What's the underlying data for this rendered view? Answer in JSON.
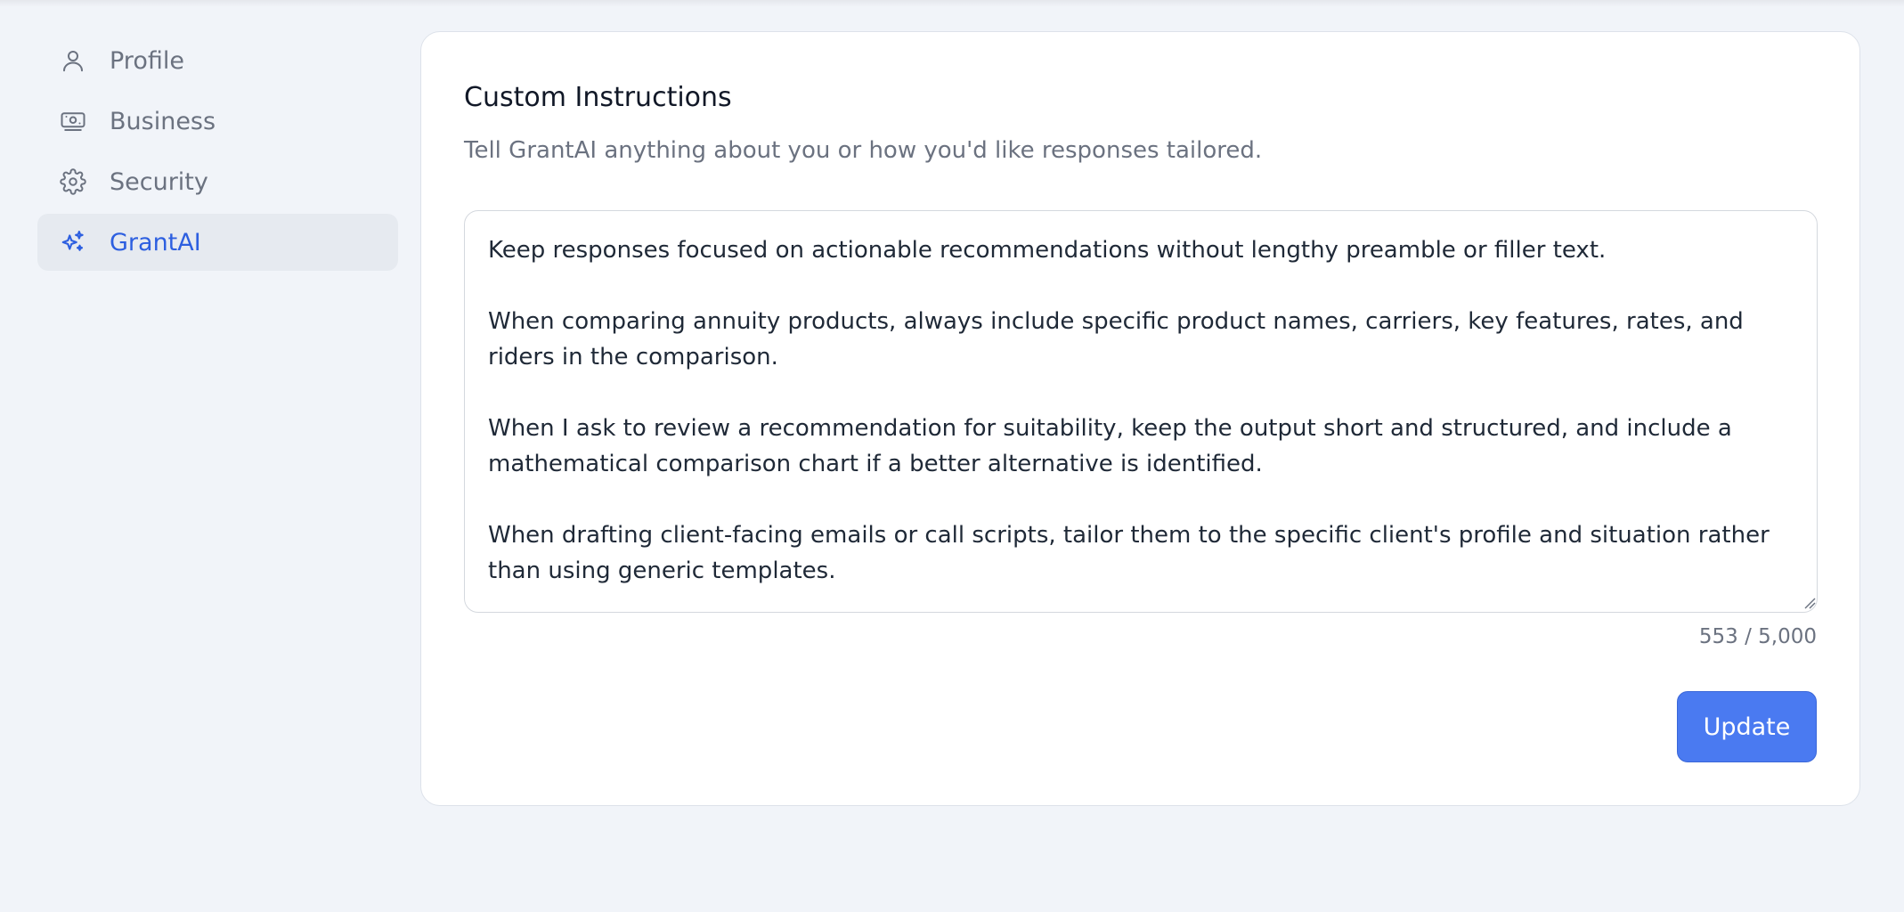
{
  "sidebar": {
    "items": [
      {
        "label": "Profile",
        "icon": "user-icon",
        "active": false
      },
      {
        "label": "Business",
        "icon": "banknote-icon",
        "active": false
      },
      {
        "label": "Security",
        "icon": "gear-icon",
        "active": false
      },
      {
        "label": "GrantAI",
        "icon": "sparkles-icon",
        "active": true
      }
    ]
  },
  "main": {
    "title": "Custom Instructions",
    "subtitle": "Tell GrantAI anything about you or how you'd like responses tailored.",
    "instructions_value": "Keep responses focused on actionable recommendations without lengthy preamble or filler text.\n\nWhen comparing annuity products, always include specific product names, carriers, key features, rates, and riders in the comparison.\n\nWhen I ask to review a recommendation for suitability, keep the output short and structured, and include a mathematical comparison chart if a better alternative is identified.\n\nWhen drafting client-facing emails or call scripts, tailor them to the specific client's profile and situation rather than using generic templates.",
    "char_count": "553 / 5,000",
    "update_label": "Update"
  },
  "colors": {
    "accent": "#4a7af1",
    "active_text": "#2d5fe0",
    "background": "#f1f4f9"
  }
}
